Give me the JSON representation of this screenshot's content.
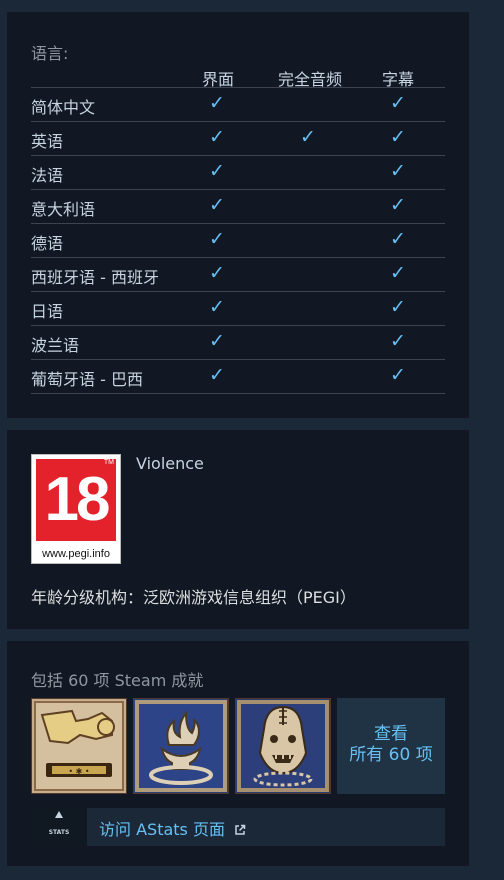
{
  "languages": {
    "title": "语言:",
    "headers": {
      "interface": "界面",
      "audio": "完全音频",
      "subtitles": "字幕"
    },
    "check_glyph": "✓",
    "rows": [
      {
        "name": "简体中文",
        "interface": true,
        "audio": false,
        "subtitles": true
      },
      {
        "name": "英语",
        "interface": true,
        "audio": true,
        "subtitles": true
      },
      {
        "name": "法语",
        "interface": true,
        "audio": false,
        "subtitles": true
      },
      {
        "name": "意大利语",
        "interface": true,
        "audio": false,
        "subtitles": true
      },
      {
        "name": "德语",
        "interface": true,
        "audio": false,
        "subtitles": true
      },
      {
        "name": "西班牙语 - 西班牙",
        "interface": true,
        "audio": false,
        "subtitles": true
      },
      {
        "name": "日语",
        "interface": true,
        "audio": false,
        "subtitles": true
      },
      {
        "name": "波兰语",
        "interface": true,
        "audio": false,
        "subtitles": true
      },
      {
        "name": "葡萄牙语 - 巴西",
        "interface": true,
        "audio": false,
        "subtitles": true
      }
    ]
  },
  "rating": {
    "badge_number": "18",
    "badge_tm": "TM",
    "badge_url": "www.pegi.info",
    "descriptor": "Violence",
    "agency": "年龄分级机构：泛欧洲游戏信息组织（PEGI）"
  },
  "achievements": {
    "title": "包括 60 项 Steam 成就",
    "icons": [
      "flexed-arm-icon",
      "flaming-chalice-icon",
      "stitched-ogre-head-icon"
    ],
    "view_all_line1": "查看",
    "view_all_line2": "所有 60 项",
    "astats_logo_text": "STATS",
    "astats_link": "访问 AStats 页面"
  },
  "colors": {
    "background": "#1b2838",
    "panel": "#111823",
    "accent": "#66c0f4",
    "pegi_red": "#e4222c"
  }
}
